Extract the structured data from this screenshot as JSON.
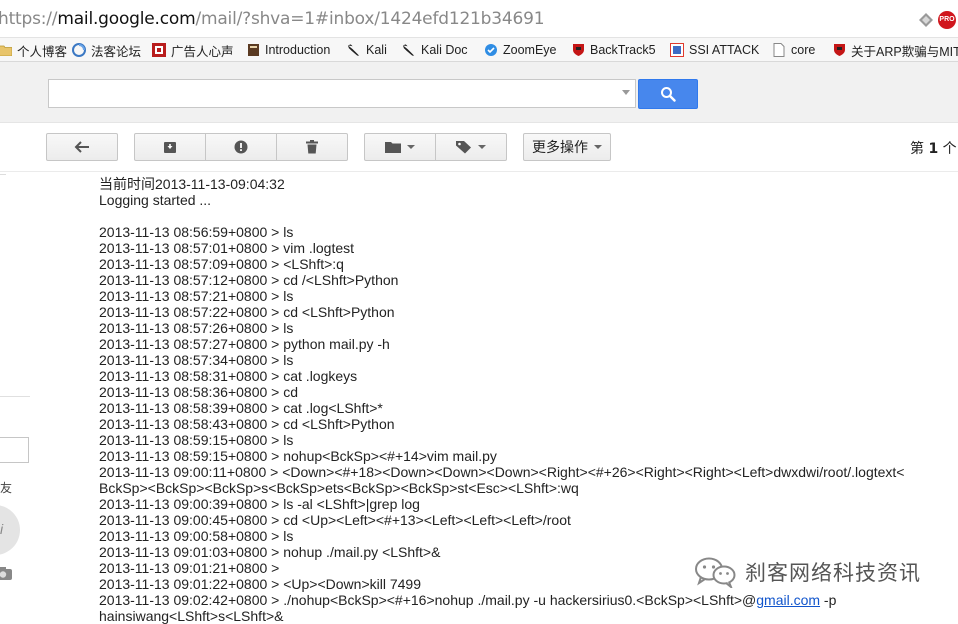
{
  "browser": {
    "url": {
      "scheme": "https://",
      "host": "mail.google.com",
      "path": "/mail/?shva=1#inbox/1424efd121b34691"
    },
    "extension_badge": "PRO",
    "bookmarks": [
      {
        "label": "个人博客",
        "icon": "folder-icon"
      },
      {
        "label": "法客论坛",
        "icon": "forum-icon"
      },
      {
        "label": "广告人心声",
        "icon": "red-square-icon"
      },
      {
        "label": "Introduction",
        "icon": "book-icon"
      },
      {
        "label": "Kali",
        "icon": "kali-dragon-icon"
      },
      {
        "label": "Kali Doc",
        "icon": "kali-dragon-icon"
      },
      {
        "label": "ZoomEye",
        "icon": "zoomeye-icon"
      },
      {
        "label": "BackTrack5",
        "icon": "shield-icon"
      },
      {
        "label": "SSI ATTACK",
        "icon": "square-icon"
      },
      {
        "label": "core",
        "icon": "page-icon"
      },
      {
        "label": "关于ARP欺骗与MIT",
        "icon": "shield-icon"
      }
    ]
  },
  "gmail": {
    "search": {
      "value": "",
      "placeholder": ""
    },
    "toolbar": {
      "more_label": "更多操作"
    },
    "pager": {
      "prefix": "第 ",
      "page": "1",
      "suffix": " 个"
    },
    "sidebar": {
      "partial_char": "友",
      "avatar_letter": "i"
    }
  },
  "message": {
    "lines": [
      "当前时间2013-11-13-09:04:32",
      "Logging started ...",
      "",
      "2013-11-13 08:56:59+0800 > ls",
      "2013-11-13 08:57:01+0800 > vim .logtest",
      "2013-11-13 08:57:09+0800 > <LShft>:q",
      "2013-11-13 08:57:12+0800 > cd /<LShft>Python",
      "2013-11-13 08:57:21+0800 > ls",
      "2013-11-13 08:57:22+0800 > cd <LShft>Python",
      "2013-11-13 08:57:26+0800 > ls",
      "2013-11-13 08:57:27+0800 > python mail.py -h",
      "2013-11-13 08:57:34+0800 > ls",
      "2013-11-13 08:58:31+0800 > cat .logkeys",
      "2013-11-13 08:58:36+0800 > cd",
      "2013-11-13 08:58:39+0800 > cat .log<LShft>*",
      "2013-11-13 08:58:43+0800 > cd <LShft>Python",
      "2013-11-13 08:59:15+0800 > ls",
      "2013-11-13 08:59:15+0800 > nohup<BckSp><#+14>vim mail.py",
      "2013-11-13 09:00:11+0800 > <Down><#+18><Down><Down><Down><Right><#+26><Right><Right><Left>dwxdwi/root/.logtext<",
      "BckSp><BckSp><BckSp>s<BckSp>ets<BckSp><BckSp>st<Esc><LShft>:wq",
      "2013-11-13 09:00:39+0800 > ls -al <LShft>|grep log",
      "2013-11-13 09:00:45+0800 > cd <Up><Left><#+13><Left><Left><Left>/root",
      "2013-11-13 09:00:58+0800 > ls",
      "2013-11-13 09:01:03+0800 > nohup ./mail.py <LShft>&",
      "2013-11-13 09:01:21+0800 >",
      "2013-11-13 09:01:22+0800 > <Up><Down>kill 7499"
    ],
    "last_line": {
      "before": "2013-11-13 09:02:42+0800 > ./nohup<BckSp><#+16>nohup ./mail.py -u hackersirius0.<BckSp><LShft>@",
      "link": "gmail.com",
      "after": " -p"
    },
    "cut_line": "hainsiwang<LShft>s<LShft>&"
  },
  "watermark": {
    "text": "刹客网络科技资讯"
  }
}
